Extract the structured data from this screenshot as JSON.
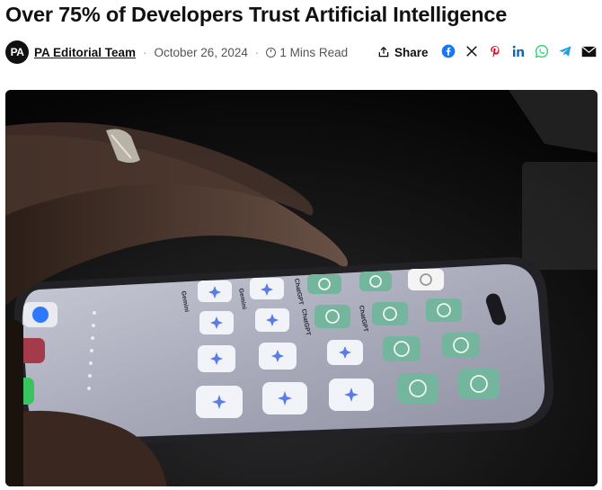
{
  "article": {
    "title": "Over 75% of Developers Trust Artificial Intelligence",
    "avatar_text": "PA",
    "author": "PA Editorial Team",
    "date": "October 26, 2024",
    "read_time": "1 Mins Read",
    "share_label": "Share"
  },
  "share_icons": [
    "facebook-icon",
    "x-icon",
    "pinterest-icon",
    "linkedin-icon",
    "whatsapp-icon",
    "telegram-icon",
    "email-icon"
  ],
  "colors": {
    "facebook": "#1877f2",
    "x": "#111111",
    "pinterest": "#e60023",
    "linkedin": "#0a66c2",
    "whatsapp": "#25d366",
    "telegram": "#229ed9",
    "email": "#111111",
    "app_gemini_bg": "#f1f3f8",
    "app_chatgpt_bg": "#74b59d"
  },
  "hero": {
    "app_labels": [
      "Gemini",
      "Gemini",
      "ChatGPT",
      "ChatGPT",
      "ChatGPT"
    ]
  }
}
